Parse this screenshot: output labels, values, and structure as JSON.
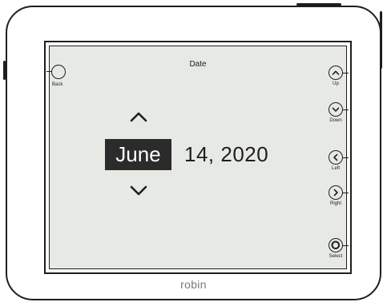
{
  "screen": {
    "title": "Date",
    "date": {
      "month": "June",
      "day": "14,",
      "year": "2020"
    }
  },
  "buttons": {
    "back": "Back",
    "up": "Up",
    "down": "Down",
    "left": "Left",
    "right": "Right",
    "select": "Select"
  },
  "brand": "robin",
  "colors": {
    "screen_bg": "#e7eae4",
    "highlight_bg": "#2b2b2b",
    "brand_text": "#777a77"
  },
  "icons": {
    "up": "chevron-up-icon",
    "down": "chevron-down-icon",
    "left": "chevron-left-icon",
    "right": "chevron-right-icon",
    "select": "select-ring-icon"
  }
}
